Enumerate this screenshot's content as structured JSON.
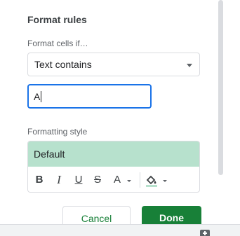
{
  "panel": {
    "title": "Format rules",
    "condition_label": "Format cells if…",
    "condition_value": "Text contains",
    "value_input": "A",
    "formatting_style_label": "Formatting style",
    "style_preview_text": "Default",
    "style_preview_color": "#b7e1cd",
    "toolbar": {
      "bold": "B",
      "italic": "I",
      "underline": "U",
      "strikethrough": "S",
      "text_color": "A"
    },
    "cancel_label": "Cancel",
    "done_label": "Done"
  },
  "colors": {
    "accent_green": "#188038",
    "focus_blue": "#1a73e8"
  }
}
